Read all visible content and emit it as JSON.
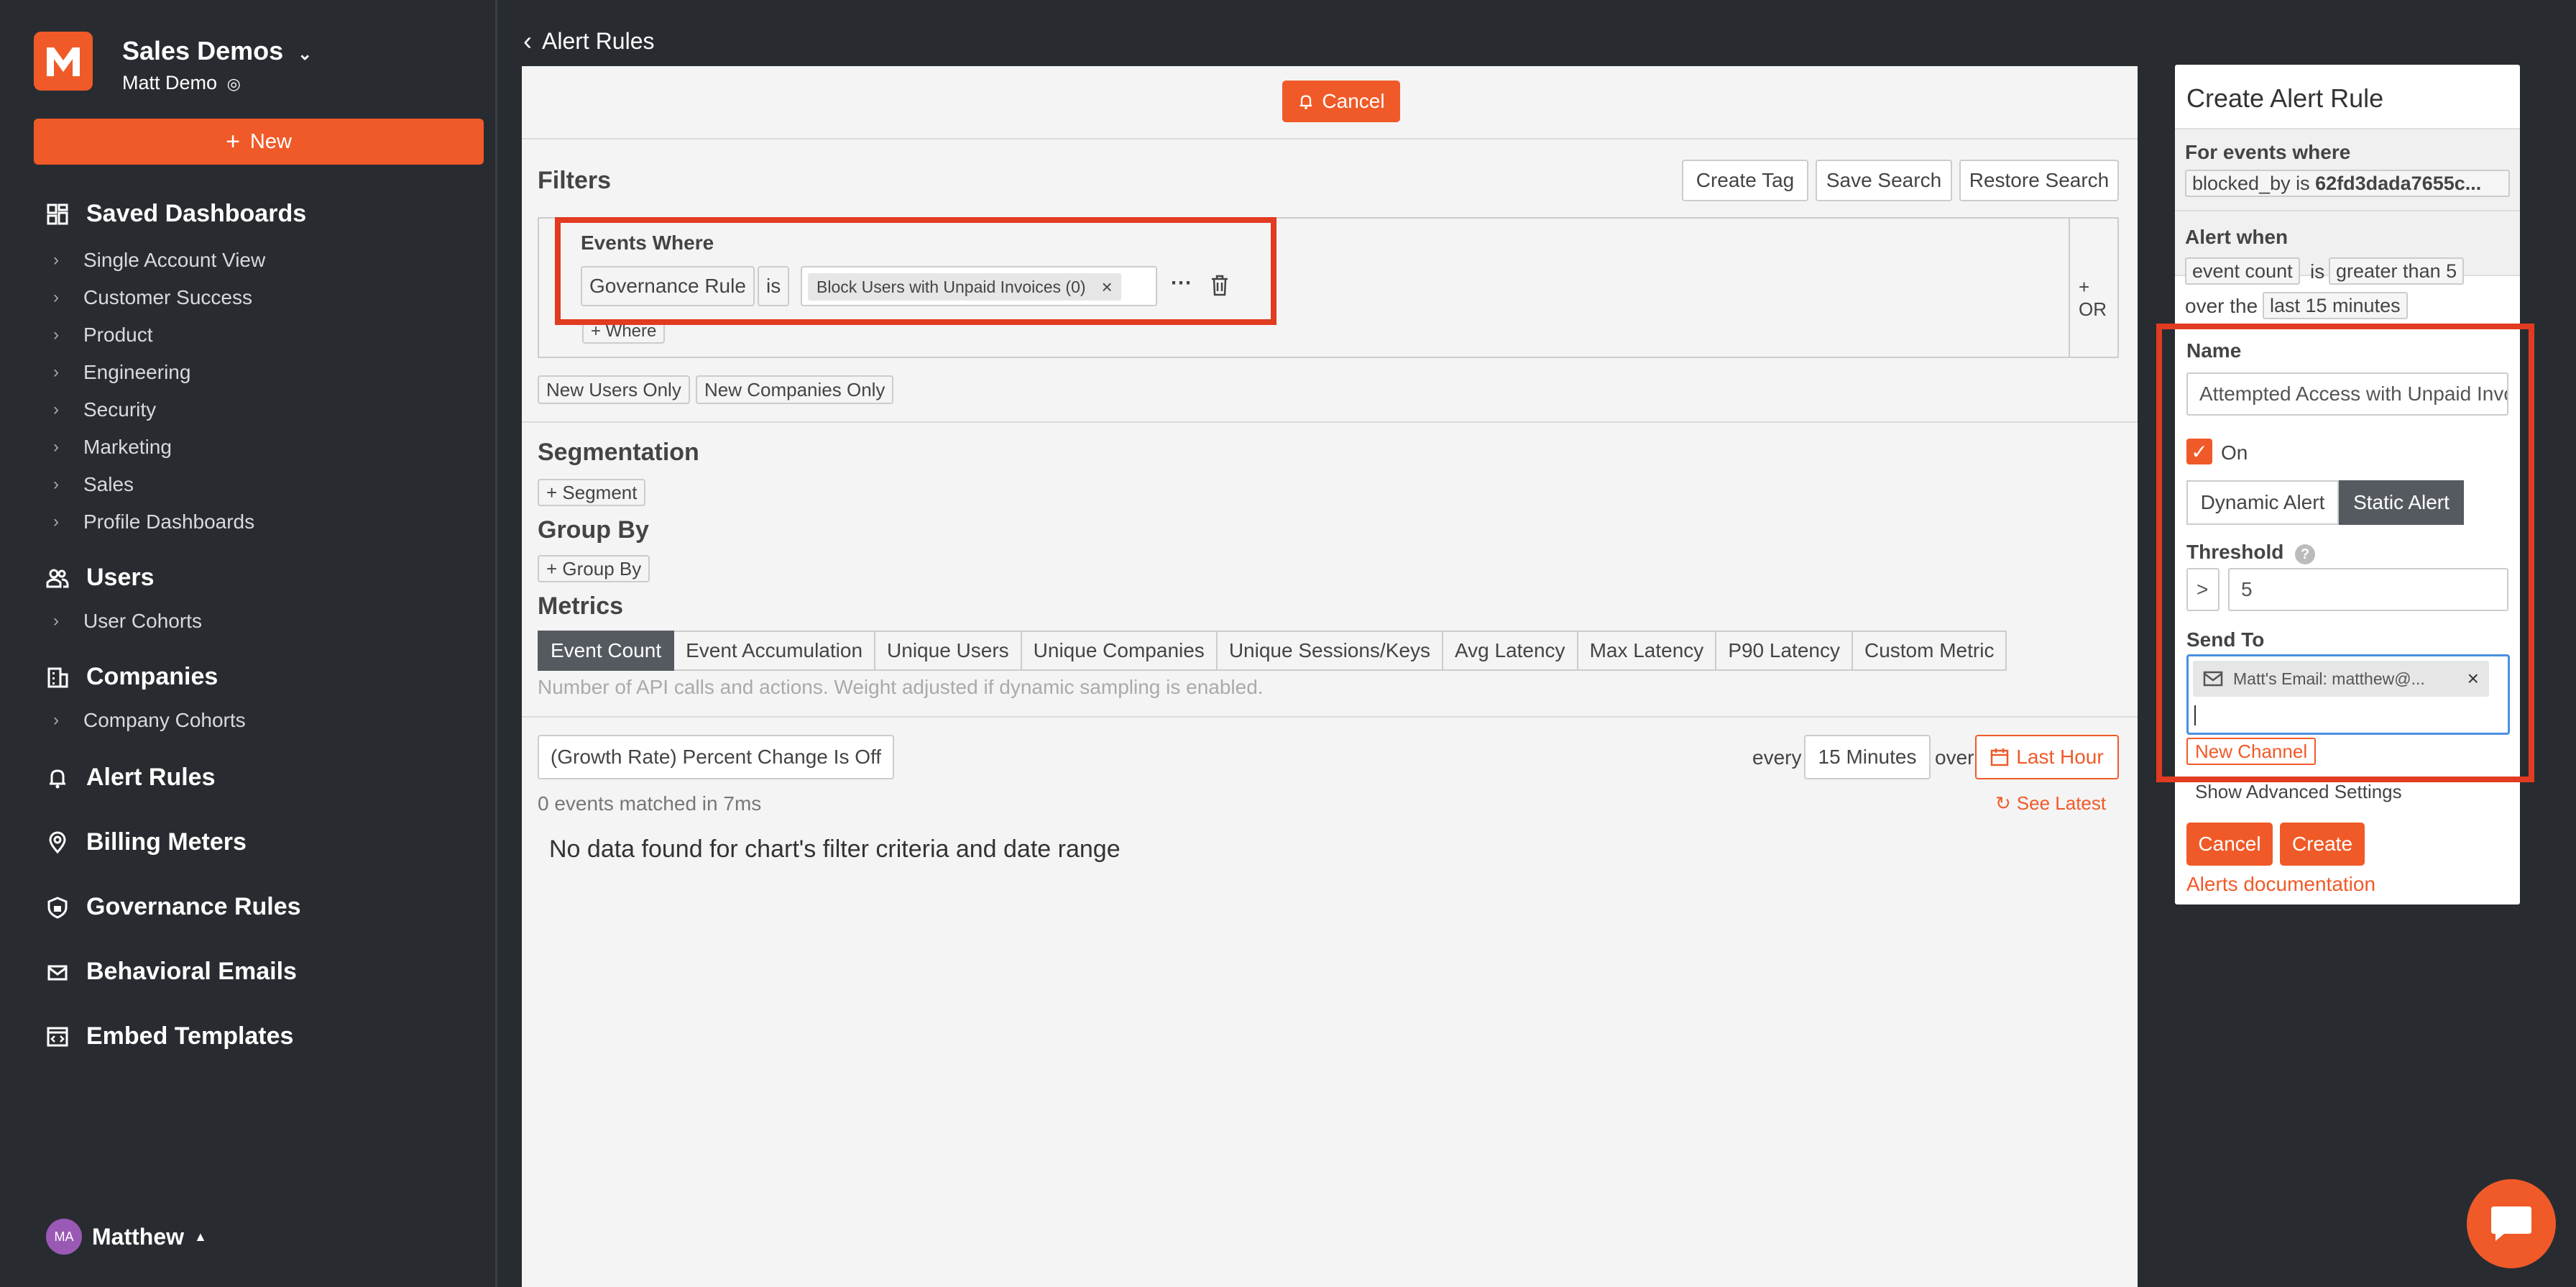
{
  "sidebar": {
    "org_name": "Sales Demos",
    "org_user": "Matt Demo",
    "new_label": "New",
    "saved_dashboards": "Saved Dashboards",
    "dashboards": [
      "Single Account View",
      "Customer Success",
      "Product",
      "Engineering",
      "Security",
      "Marketing",
      "Sales",
      "Profile Dashboards"
    ],
    "users": "Users",
    "user_cohorts": "User Cohorts",
    "companies": "Companies",
    "company_cohorts": "Company Cohorts",
    "alert_rules": "Alert Rules",
    "billing_meters": "Billing Meters",
    "governance_rules": "Governance Rules",
    "behavioral_emails": "Behavioral Emails",
    "embed_templates": "Embed Templates",
    "user_name": "Matthew",
    "user_initials": "MA"
  },
  "header": {
    "breadcrumb": "Alert Rules",
    "cancel": "Cancel"
  },
  "filters": {
    "title": "Filters",
    "create_tag": "Create Tag",
    "save_search": "Save Search",
    "restore_search": "Restore Search",
    "events_where": "Events Where",
    "field": "Governance Rule",
    "operator": "is",
    "value": "Block Users with Unpaid Invoices (0)",
    "add_where": "+ Where",
    "or": "+ OR",
    "new_users_only": "New Users Only",
    "new_companies_only": "New Companies Only"
  },
  "segmentation": {
    "title": "Segmentation",
    "add": "+ Segment"
  },
  "group_by": {
    "title": "Group By",
    "add": "+ Group By"
  },
  "metrics": {
    "title": "Metrics",
    "tabs": [
      "Event Count",
      "Event Accumulation",
      "Unique Users",
      "Unique Companies",
      "Unique Sessions/Keys",
      "Avg Latency",
      "Max Latency",
      "P90 Latency",
      "Custom Metric"
    ],
    "hint": "Number of API calls and actions. Weight adjusted if dynamic sampling is enabled."
  },
  "chart_controls": {
    "growth": "(Growth Rate) Percent Change Is Off",
    "every": "every",
    "interval": "15 Minutes",
    "over": "over",
    "range": "Last Hour",
    "matched": "0 events matched in 7ms",
    "see_latest": "See Latest",
    "no_data": "No data found for chart's filter criteria and date range"
  },
  "panel": {
    "title": "Create Alert Rule",
    "for_events": "For events where",
    "filter_key": "blocked_by is",
    "filter_val": "62fd3dada7655c...",
    "alert_when": "Alert when",
    "metric": "event count",
    "is": "is",
    "condition": "greater than 5",
    "over_the": "over the",
    "window": "last 15 minutes",
    "name_label": "Name",
    "name_value": "Attempted Access with Unpaid Invoices",
    "on_label": "On",
    "dynamic": "Dynamic Alert",
    "static": "Static Alert",
    "threshold_label": "Threshold",
    "threshold_op": ">",
    "threshold_val": "5",
    "send_to_label": "Send To",
    "channel": "Matt's Email: matthew@...",
    "new_channel": "New Channel",
    "advanced": "Show Advanced Settings",
    "cancel": "Cancel",
    "create": "Create",
    "docs": "Alerts documentation"
  },
  "colors": {
    "accent": "#f05a28",
    "highlight": "#e13b22",
    "sidebar_bg": "#282c31"
  }
}
